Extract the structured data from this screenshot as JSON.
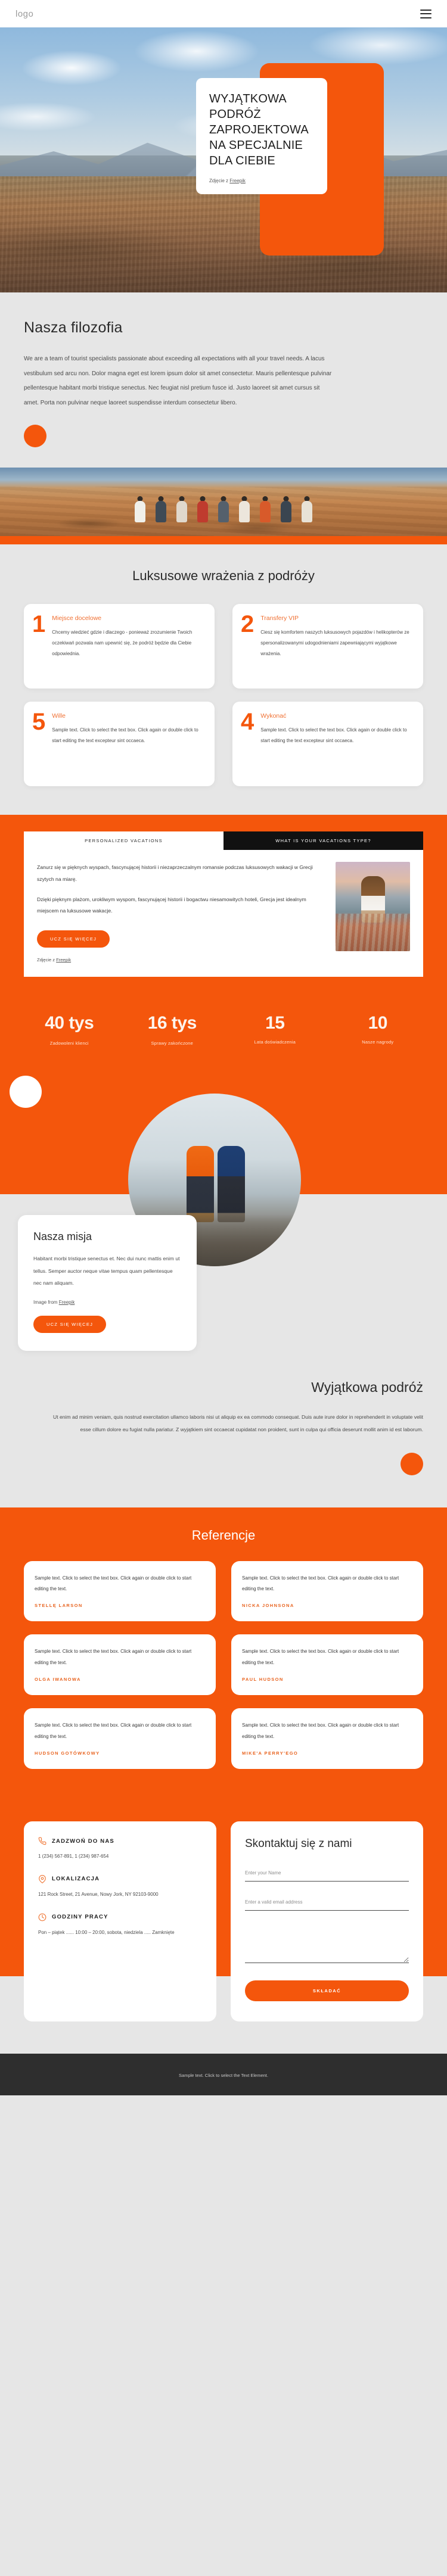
{
  "header": {
    "logo": "logo",
    "menu_icon": "hamburger-icon"
  },
  "hero": {
    "title": "WYJĄTKOWA PODRÓŻ ZAPROJEKTOWANA SPECJALNIE DLA CIEBIE",
    "credit_prefix": "Zdjęcie z ",
    "credit_link": "Freepik"
  },
  "philosophy": {
    "title": "Nasza filozofia",
    "paragraph": "We are a team of tourist specialists passionate about exceeding all expectations with all your travel needs. A lacus vestibulum sed arcu non. Dolor magna eget est lorem ipsum dolor sit amet consectetur. Mauris pellentesque pulvinar pellentesque habitant morbi tristique senectus. Nec feugiat nisl pretium fusce id. Justo laoreet sit amet cursus sit amet. Porta non pulvinar neque laoreet suspendisse interdum consectetur libero."
  },
  "luxury": {
    "title": "Luksusowe wrażenia z podróży",
    "cards": [
      {
        "number": "1",
        "heading": "Miejsce docelowe",
        "text": "Chcemy wiedzieć gdzie i dlaczego - ponieważ zrozumienie Twoich oczekiwań pozwala nam upewnić się, że podróż będzie dla Ciebie odpowiednia."
      },
      {
        "number": "2",
        "heading": "Transfery VIP",
        "text": "Ciesz się komfortem naszych luksusowych pojazdów i helikopterów ze spersonalizowanymi udogodnieniami zapewniającymi wyjątkowe wrażenia."
      },
      {
        "number": "5",
        "heading": "Wille",
        "text": "Sample text. Click to select the text box. Click again or double click to start editing the text excepteur sint occaeca."
      },
      {
        "number": "4",
        "heading": "Wykonać",
        "text": "Sample text. Click to select the text box. Click again or double click to start editing the text excepteur sint occaeca."
      }
    ]
  },
  "vacations": {
    "tab_active": "PERSONALIZED VACATIONS",
    "tab_inactive": "WHAT IS YOUR VACATIONS TYPE?",
    "paragraph1": "Zanurz się w pięknych wyspach, fascynującej historii i niezaprzeczalnym romansie podczas luksusowych wakacji w Grecji szytych na miarę.",
    "paragraph2": "Dzięki pięknym plażom, urokliwym wyspom, fascynującej historii i bogactwu niesamowitych hoteli, Grecja jest idealnym miejscem na luksusowe wakacje.",
    "button": "UCZ SIĘ WIĘCEJ",
    "credit_prefix": "Zdjęcie z ",
    "credit_link": "Freepik"
  },
  "stats": [
    {
      "value": "40 tys",
      "label": "Zadowoleni klienci"
    },
    {
      "value": "16 tys",
      "label": "Sprawy zakończone"
    },
    {
      "value": "15",
      "label": "Lata doświadczenia"
    },
    {
      "value": "10",
      "label": "Nasze nagrody"
    }
  ],
  "mission": {
    "title": "Nasza misja",
    "paragraph": "Habitant morbi tristique senectus et. Nec dui nunc mattis enim ut tellus. Semper auctor neque vitae tempus quam pellentesque nec nam aliquam.",
    "credit_prefix": "Image from ",
    "credit_link": "Freepik",
    "button": "UCZ SIĘ WIĘCEJ"
  },
  "unique": {
    "title": "Wyjątkowa podróż",
    "paragraph": "Ut enim ad minim veniam, quis nostrud exercitation ullamco laboris nisi ut aliquip ex ea commodo consequat. Duis aute irure dolor in reprehenderit in voluptate velit esse cillum dolore eu fugiat nulla pariatur. Z wyjątkiem sint occaecat cupidatat non proident, sunt in culpa qui officia deserunt mollit anim id est laborum."
  },
  "testimonials": {
    "title": "Referencje",
    "items": [
      {
        "text": "Sample text. Click to select the text box. Click again or double click to start editing the text.",
        "name": "STELLĘ LARSON"
      },
      {
        "text": "Sample text. Click to select the text box. Click again or double click to start editing the text.",
        "name": "NICKA JOHNSONA"
      },
      {
        "text": "Sample text. Click to select the text box. Click again or double click to start editing the text.",
        "name": "OLGA IWANOWA"
      },
      {
        "text": "Sample text. Click to select the text box. Click again or double click to start editing the text.",
        "name": "PAUL HUDSON"
      },
      {
        "text": "Sample text. Click to select the text box. Click again or double click to start editing the text.",
        "name": "HUDSON GOTÓWKOWY"
      },
      {
        "text": "Sample text. Click to select the text box. Click again or double click to start editing the text.",
        "name": "MIKE'A PERRY'EGO"
      }
    ]
  },
  "contact": {
    "phone_title": "ZADZWOŃ DO NAS",
    "phone_icon": "phone-icon",
    "phone_value": "1 (234) 567-891, 1 (234) 987-654",
    "location_title": "LOKALIZACJA",
    "location_icon": "map-pin-icon",
    "location_value": "121 Rock Street, 21 Avenue, Nowy Jork, NY 92103-9000",
    "hours_title": "GODZINY PRACY",
    "hours_icon": "clock-icon",
    "hours_value": "Pon – piątek ...... 10:00 – 20:00, sobota, niedziela ..... Zamknięte",
    "form_title": "Skontaktuj się z nami",
    "name_placeholder": "Enter your Name",
    "email_placeholder": "Enter a valid email address",
    "message_placeholder": "",
    "submit_label": "SKŁADAĆ"
  },
  "footer": {
    "text": "Sample text. Click to select the Text Element."
  },
  "colors": {
    "accent": "#f4560c",
    "accent_light": "#f07032",
    "page_bg": "#e6e6e6",
    "dark": "#2e2e2e"
  }
}
